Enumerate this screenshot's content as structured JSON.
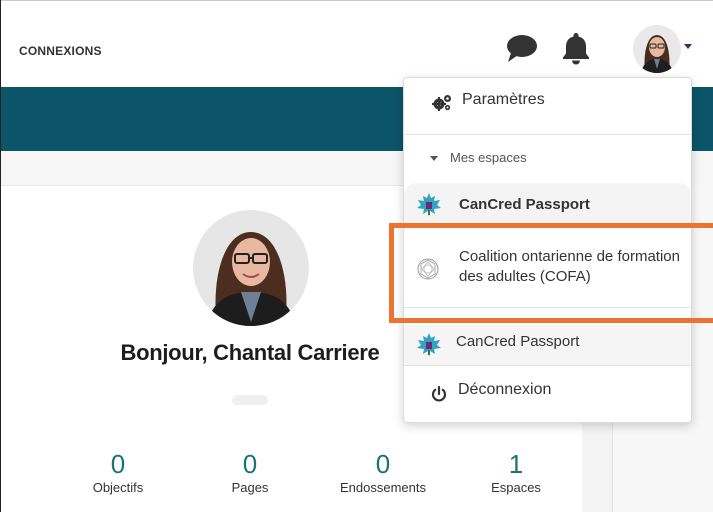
{
  "header": {
    "brand": "CONNEXIONS",
    "chat_icon": "chat-bubble-icon",
    "bell_icon": "bell-icon",
    "avatar_icon": "user-avatar"
  },
  "profile": {
    "greeting": "Bonjour, Chantal Carriere",
    "stats": [
      {
        "value": "0",
        "label": "Objectifs"
      },
      {
        "value": "0",
        "label": "Pages"
      },
      {
        "value": "0",
        "label": "Endossements"
      },
      {
        "value": "1",
        "label": "Espaces"
      }
    ]
  },
  "menu": {
    "settings": "Paramètres",
    "section": "Mes espaces",
    "spaces": [
      "CanCred Passport",
      "Coalition ontarienne de formation des adultes (COFA)",
      "CanCred Passport"
    ],
    "logout": "Déconnexion"
  },
  "colors": {
    "banner": "#0c5468",
    "accent": "#1e7370",
    "highlight": "#ed7331",
    "icon": "#333333"
  }
}
